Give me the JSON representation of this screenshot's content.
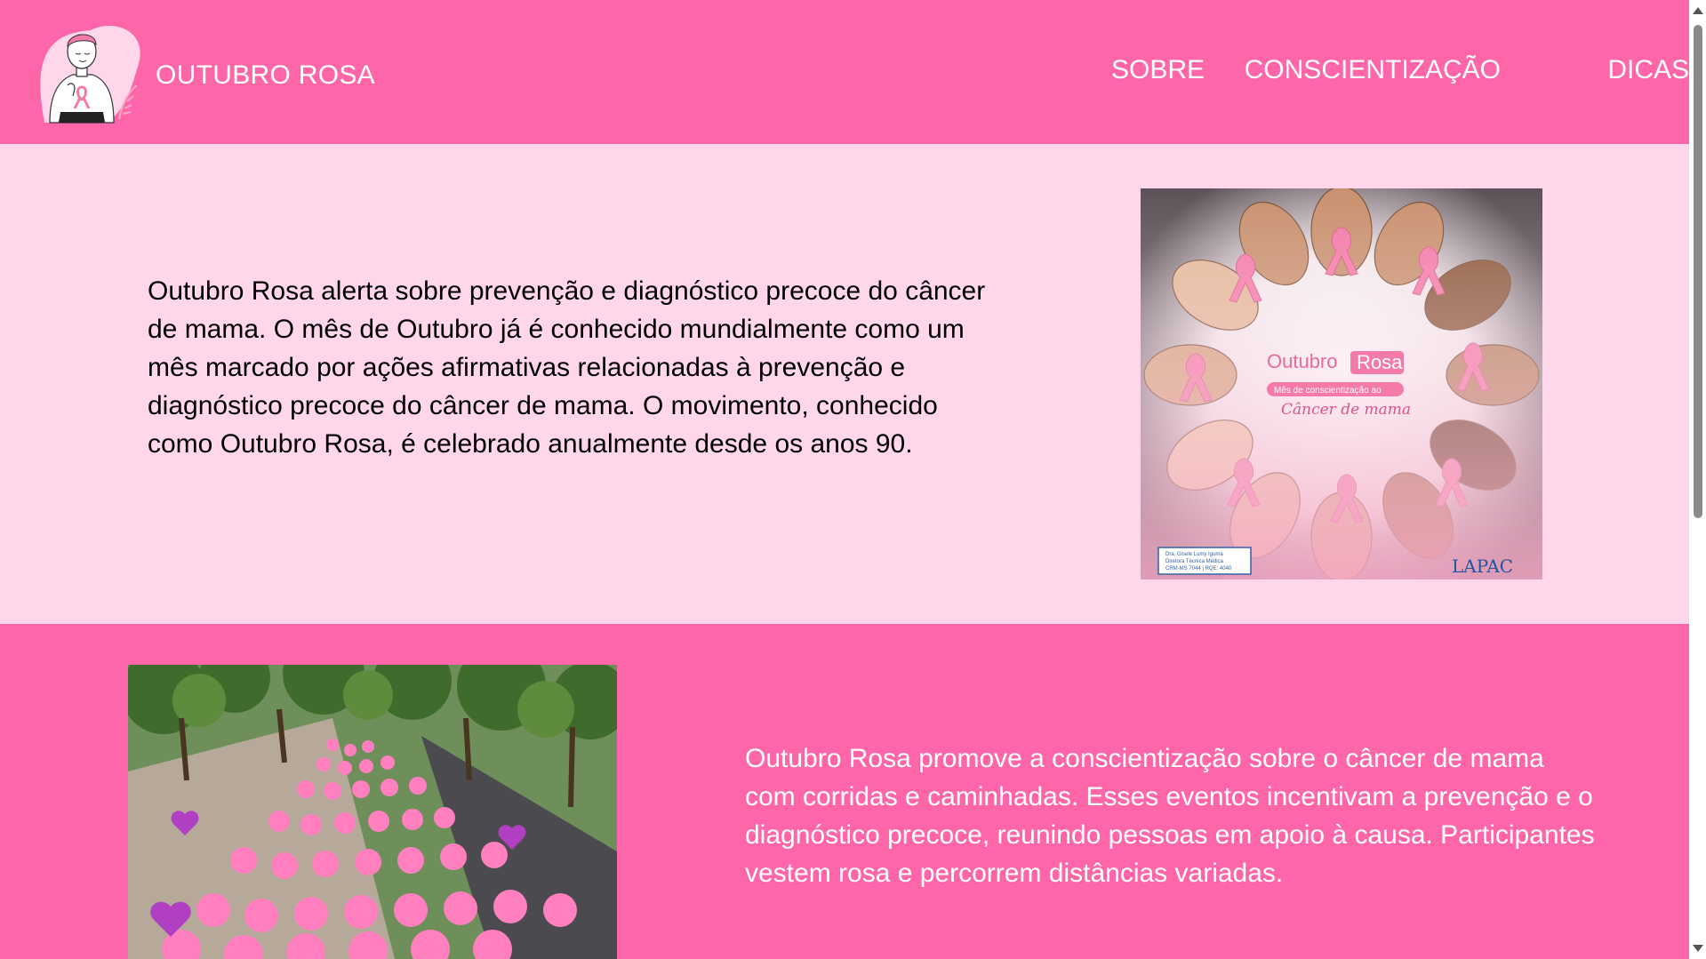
{
  "header": {
    "brand": "OUTUBRO ROSA",
    "nav": [
      "SOBRE",
      "CONSCIENTIZAÇÃO",
      "DICAS"
    ]
  },
  "section_awareness": {
    "text": "Outubro Rosa alerta sobre prevenção e diagnóstico precoce do câncer de mama. O mês de Outubro já é conhecido mundialmente como um mês marcado por ações afirmativas relacionadas à prevenção e diagnóstico precoce do câncer de mama. O movimento, conhecido como Outubro Rosa, é celebrado anualmente desde os anos 90.",
    "image": {
      "title_a": "Outubro",
      "title_b": "Rosa",
      "subtitle": "Mês de conscientização ao",
      "script": "Câncer de mama",
      "card_lines": [
        "Dra. Gisele Lumy Iguma",
        "Diretora Técnica Médica",
        "CRM-MS 7044 | RQE: 4040"
      ],
      "brand": "LAPAC"
    }
  },
  "section_events": {
    "text": "Outubro Rosa promove a conscientização sobre o câncer de mama com corridas e caminhadas. Esses eventos incentivam a prevenção e o diagnóstico precoce, reunindo pessoas em apoio à causa. Participantes vestem rosa e percorrem distâncias variadas."
  },
  "colors": {
    "primary_pink": "#ff66aa",
    "light_pink": "#ffd6ea",
    "ribbon_pink": "#f47aa8"
  }
}
